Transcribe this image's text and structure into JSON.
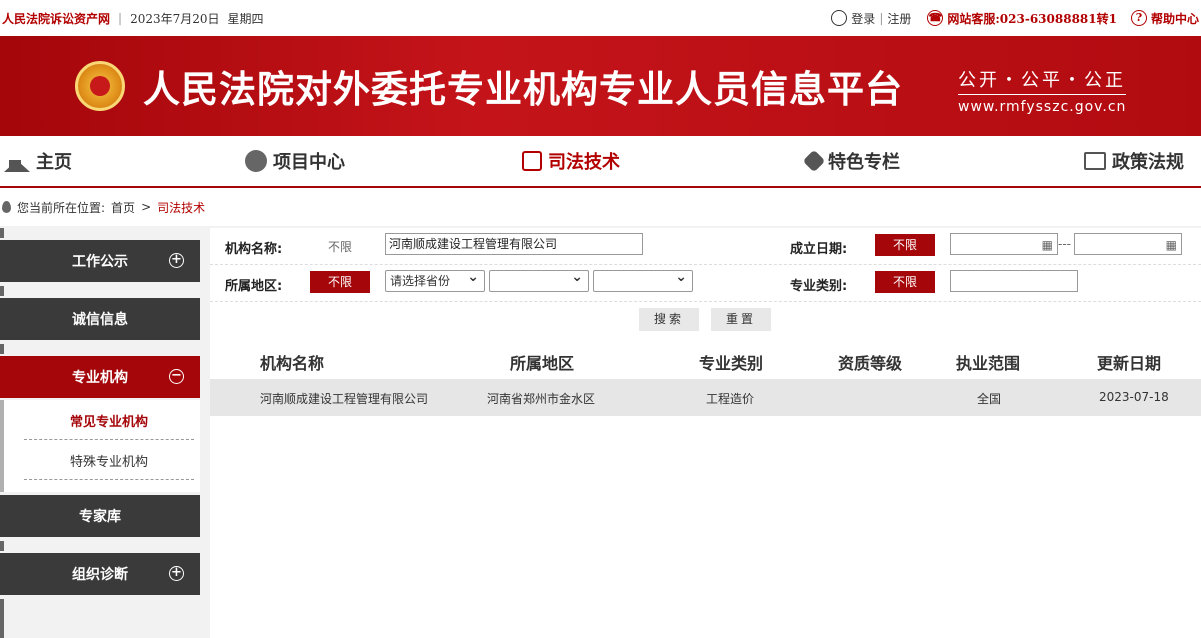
{
  "topbar": {
    "site_name": "人民法院诉讼资产网",
    "separator": "|",
    "date": "2023年7月20日",
    "weekday": "星期四",
    "login": "登录",
    "divider": "|",
    "register": "注册",
    "service": "网站客服:023-63088881转1",
    "help": "帮助中心"
  },
  "banner": {
    "title": "人民法院对外委托专业机构专业人员信息平台",
    "slogan": "公开・公平・公正",
    "url": "www.rmfysszc.gov.cn"
  },
  "nav": {
    "items": [
      {
        "label": "主页",
        "icon": "home-icon"
      },
      {
        "label": "项目中心",
        "icon": "gavel-icon"
      },
      {
        "label": "司法技术",
        "icon": "scale-icon",
        "active": true
      },
      {
        "label": "特色专栏",
        "icon": "badge-icon"
      },
      {
        "label": "政策法规",
        "icon": "book-icon"
      }
    ]
  },
  "breadcrumb": {
    "prefix": "您当前所在位置:",
    "home": "首页",
    "arrow": ">",
    "current": "司法技术"
  },
  "sidebar": {
    "items": [
      {
        "label": "工作公示",
        "toggle": "+"
      },
      {
        "label": "诚信信息"
      },
      {
        "label": "专业机构",
        "toggle": "−",
        "active": true
      },
      {
        "label": "专家库"
      },
      {
        "label": "组织诊断",
        "toggle": "+"
      }
    ],
    "subitems": [
      {
        "label": "常见专业机构",
        "active": true
      },
      {
        "label": "特殊专业机构"
      }
    ]
  },
  "filters": {
    "org_name_label": "机构名称:",
    "org_name_unlimited": "不限",
    "org_name_value": "河南顺成建设工程管理有限公司",
    "founded_label": "成立日期:",
    "founded_unlimited": "不限",
    "date_sep": "---",
    "region_label": "所属地区:",
    "region_unlimited": "不限",
    "province_placeholder": "请选择省份",
    "city_value": "",
    "district_value": "",
    "category_label": "专业类别:",
    "category_unlimited": "不限",
    "search_button": "搜索",
    "reset_button": "重置"
  },
  "table": {
    "headers": [
      "机构名称",
      "所属地区",
      "专业类别",
      "资质等级",
      "执业范围",
      "更新日期"
    ],
    "rows": [
      [
        "河南顺成建设工程管理有限公司",
        "河南省郑州市金水区",
        "工程造价",
        "",
        "全国",
        "2023-07-18"
      ]
    ]
  },
  "colors": {
    "brand_red": "#a4060a",
    "dark_menu": "#3a3a3a"
  }
}
